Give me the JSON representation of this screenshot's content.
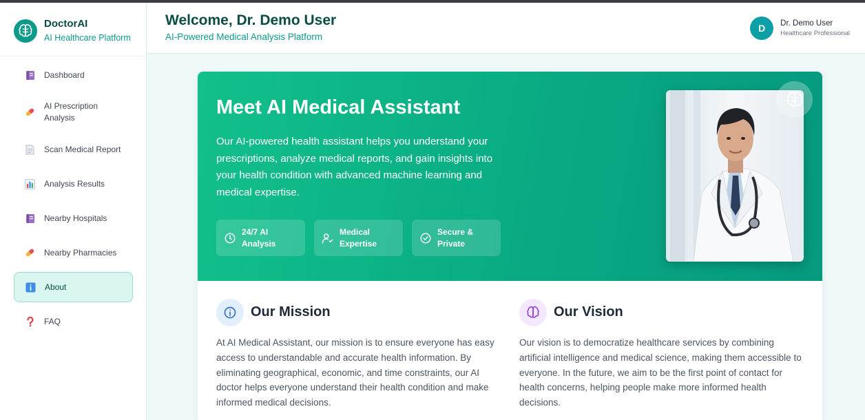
{
  "brand": {
    "name": "DoctorAI",
    "subtitle": "AI Healthcare Platform",
    "icon": "brain-icon"
  },
  "sidebar": {
    "items": [
      {
        "label": "Dashboard",
        "icon": "book-icon",
        "active": false
      },
      {
        "label": "AI Prescription Analysis",
        "icon": "pill-icon",
        "active": false
      },
      {
        "label": "Scan Medical Report",
        "icon": "document-icon",
        "active": false
      },
      {
        "label": "Analysis Results",
        "icon": "bar-chart-icon",
        "active": false
      },
      {
        "label": "Nearby Hospitals",
        "icon": "book-icon",
        "active": false
      },
      {
        "label": "Nearby Pharmacies",
        "icon": "pill-icon",
        "active": false
      },
      {
        "label": "About",
        "icon": "info-icon",
        "active": true
      },
      {
        "label": "FAQ",
        "icon": "question-icon",
        "active": false
      }
    ]
  },
  "header": {
    "title": "Welcome, Dr. Demo User",
    "subtitle": "AI-Powered Medical Analysis Platform",
    "user": {
      "initial": "D",
      "name": "Dr. Demo User",
      "role": "Healthcare Professional"
    }
  },
  "hero": {
    "title": "Meet AI Medical Assistant",
    "description": "Our AI-powered health assistant helps you understand your prescriptions, analyze medical reports, and gain insights into your health condition with advanced machine learning and medical expertise.",
    "features": [
      {
        "label": "24/7 AI Analysis",
        "icon": "clock-icon"
      },
      {
        "label": "Medical Expertise",
        "icon": "user-check-icon"
      },
      {
        "label": "Secure & Private",
        "icon": "check-circle-icon"
      }
    ],
    "photo": {
      "subject": "doctor-portrait",
      "badge_icon": "brain-icon"
    }
  },
  "mission": {
    "title": "Our Mission",
    "icon": "info-circle-icon",
    "text": "At AI Medical Assistant, our mission is to ensure everyone has easy access to understandable and accurate health information. By eliminating geographical, economic, and time constraints, our AI doctor helps everyone understand their health condition and make informed medical decisions."
  },
  "vision": {
    "title": "Our Vision",
    "icon": "brain-icon",
    "text": "Our vision is to democratize healthcare services by combining artificial intelligence and medical science, making them accessible to everyone. In the future, we aim to be the first point of contact for health concerns, helping people make more informed health decisions."
  },
  "colors": {
    "brand": "#0d9a8a",
    "brand_dark": "#0b4d46",
    "hero_start": "#12c08b",
    "hero_end": "#06997f",
    "active_bg": "#d9f6f0",
    "mission_icon_bg": "#e3eefc",
    "vision_icon_bg": "#f3e8fd"
  }
}
